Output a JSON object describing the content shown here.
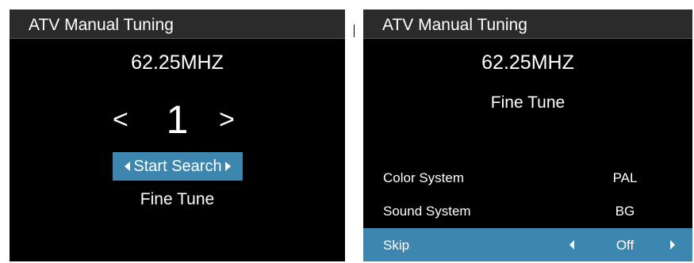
{
  "left_panel": {
    "title": "ATV Manual Tuning",
    "frequency": "62.25MHZ",
    "channel": "1",
    "prev_symbol": "<",
    "next_symbol": ">",
    "start_search_label": "Start Search",
    "fine_tune_label": "Fine Tune"
  },
  "right_panel": {
    "title": "ATV Manual Tuning",
    "frequency": "62.25MHZ",
    "fine_tune_label": "Fine Tune",
    "settings": [
      {
        "label": "Color System",
        "value": "PAL",
        "selected": false
      },
      {
        "label": "Sound System",
        "value": "BG",
        "selected": false
      },
      {
        "label": "Skip",
        "value": "Off",
        "selected": true
      }
    ]
  },
  "colors": {
    "highlight": "#3d86b0",
    "title_bar": "#2b2b2b",
    "background": "#000000",
    "text": "#ffffff"
  }
}
